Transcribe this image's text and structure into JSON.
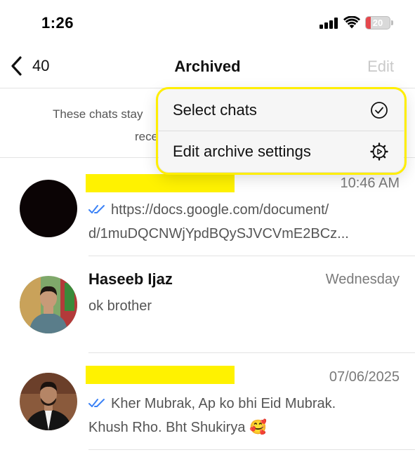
{
  "status_bar": {
    "time": "1:26",
    "battery_level": "20",
    "battery_fraction": 0.2
  },
  "nav": {
    "back_count": "40",
    "title": "Archived",
    "edit_label": "Edit"
  },
  "info_banner": {
    "line1": "These chats stay",
    "line2": "rece"
  },
  "context_menu": {
    "items": [
      {
        "label": "Select chats",
        "icon": "check-circle-icon"
      },
      {
        "label": "Edit archive settings",
        "icon": "settings-gear-icon"
      }
    ]
  },
  "chats": [
    {
      "name": "",
      "name_redacted": true,
      "time": "10:46 AM",
      "read_receipt": "double-check-blue",
      "preview_line1": "https://docs.google.com/document/",
      "preview_line2": "d/1muDQCNWjYpdBQySJVCVmE2BCz..."
    },
    {
      "name": "Haseeb Ijaz",
      "time": "Wednesday",
      "preview_line1": "ok brother"
    },
    {
      "name": "",
      "name_redacted": true,
      "time": "07/06/2025",
      "read_receipt": "double-check-blue",
      "preview_line1": "Kher Mubrak, Ap ko bhi Eid Mubrak.",
      "preview_line2": "Khush Rho. Bht Shukirya 🥰"
    }
  ],
  "colors": {
    "read_tick": "#3b82f6",
    "highlight": "#ffee00",
    "redaction": "#fff200",
    "battery_low": "#e5484d"
  }
}
